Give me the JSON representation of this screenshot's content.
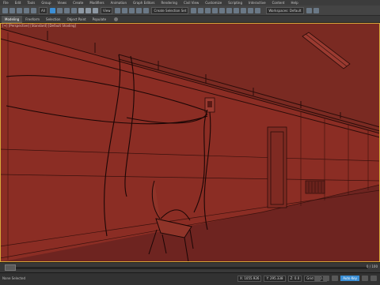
{
  "menu": [
    "File",
    "Edit",
    "Tools",
    "Group",
    "Views",
    "Create",
    "Modifiers",
    "Animation",
    "Graph Editors",
    "Rendering",
    "Civil View",
    "Customize",
    "Scripting",
    "Interactive",
    "Content",
    "Help"
  ],
  "toolbar": {
    "selection_filter": "All",
    "view_dropdown": "View",
    "named_selection": "Create Selection Set",
    "workspace": "Workspaces: Default"
  },
  "ribbon": {
    "tabs": [
      "Modeling",
      "Freeform",
      "Selection",
      "Object Paint",
      "Populate"
    ],
    "selected": "Modeling"
  },
  "viewport": {
    "label": "[+] [Perspective] [Standard] [Default Shading]",
    "wall_color": "#8b2d24",
    "floor_color": "#6e2420",
    "ceiling_color": "#7a2a22",
    "line_color": "#2a0c09"
  },
  "timeline": {
    "frame": "0 / 100"
  },
  "status": {
    "left": "None Selected",
    "x": "X: 1055.926",
    "y": "Y: 295.338",
    "z": "Z: 0.0",
    "grid": "Grid = 10.0",
    "key": "Auto Key"
  }
}
